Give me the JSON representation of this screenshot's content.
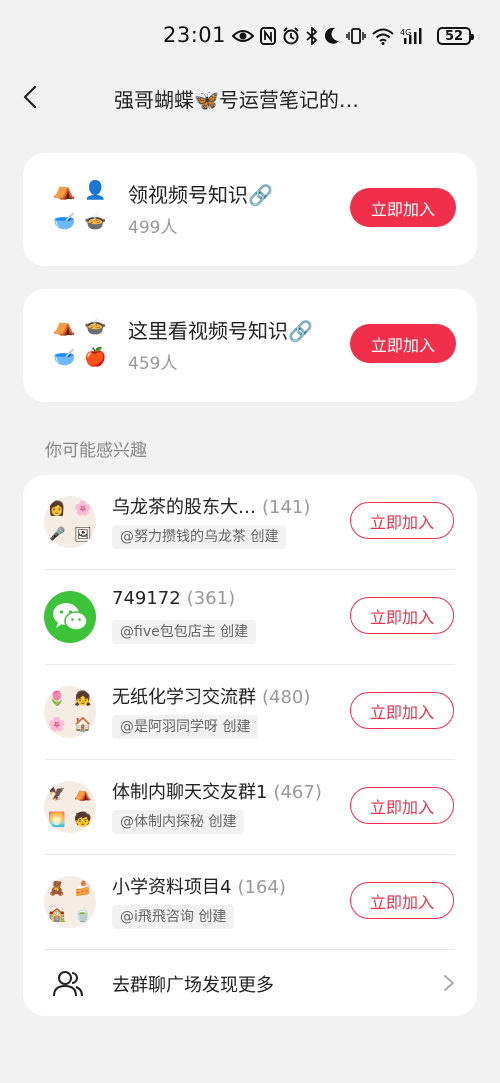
{
  "status_bar": {
    "time": "23:01",
    "battery": "52",
    "icons": [
      "eye-icon",
      "nfc-icon",
      "alarm-icon",
      "bluetooth-icon",
      "moon-icon",
      "vibrate-icon",
      "wifi-icon",
      "signal-4g-icon"
    ]
  },
  "header": {
    "title": "强哥蝴蝶🦋号运营笔记的…"
  },
  "groups": [
    {
      "name": "领视频号知识🔗",
      "count": "499人",
      "join_label": "立即加入",
      "avatar_icons": [
        "⛺",
        "👤",
        "🥣",
        "🍲"
      ]
    },
    {
      "name": "这里看视频号知识🔗",
      "count": "459人",
      "join_label": "立即加入",
      "avatar_icons": [
        "⛺",
        "🍲",
        "🥣",
        "🍎"
      ]
    }
  ],
  "section_title": "你可能感兴趣",
  "recommendations": [
    {
      "name": "乌龙茶的股东大…",
      "count": "(141)",
      "creator": "@努力攒钱的乌龙茶 创建",
      "join_label": "立即加入",
      "avatar_icons": [
        "👩",
        "🌸",
        "🎤",
        "🖼"
      ]
    },
    {
      "name": "749172",
      "count": "(361)",
      "creator": "@five包包店主 创建",
      "join_label": "立即加入",
      "avatar_icons": [
        "💬"
      ]
    },
    {
      "name": "无纸化学习交流群",
      "count": "(480)",
      "creator": "@是阿羽同学呀 创建",
      "join_label": "立即加入",
      "avatar_icons": [
        "🌷",
        "👧",
        "🌸",
        "🏠"
      ]
    },
    {
      "name": "体制内聊天交友群1",
      "count": "(467)",
      "creator": "@体制内探秘 创建",
      "join_label": "立即加入",
      "avatar_icons": [
        "🦅",
        "⛺",
        "🌅",
        "🧒"
      ]
    },
    {
      "name": "小学资料项目4",
      "count": "(164)",
      "creator": "@i飛飛咨询 创建",
      "join_label": "立即加入",
      "avatar_icons": [
        "🧸",
        "🍰",
        "🏫",
        "🍵"
      ]
    }
  ],
  "more": {
    "label": "去群聊广场发现更多"
  },
  "colors": {
    "accent": "#f0304a",
    "background": "#f2f2f2",
    "card": "#ffffff",
    "wechat": "#3dc33a"
  }
}
